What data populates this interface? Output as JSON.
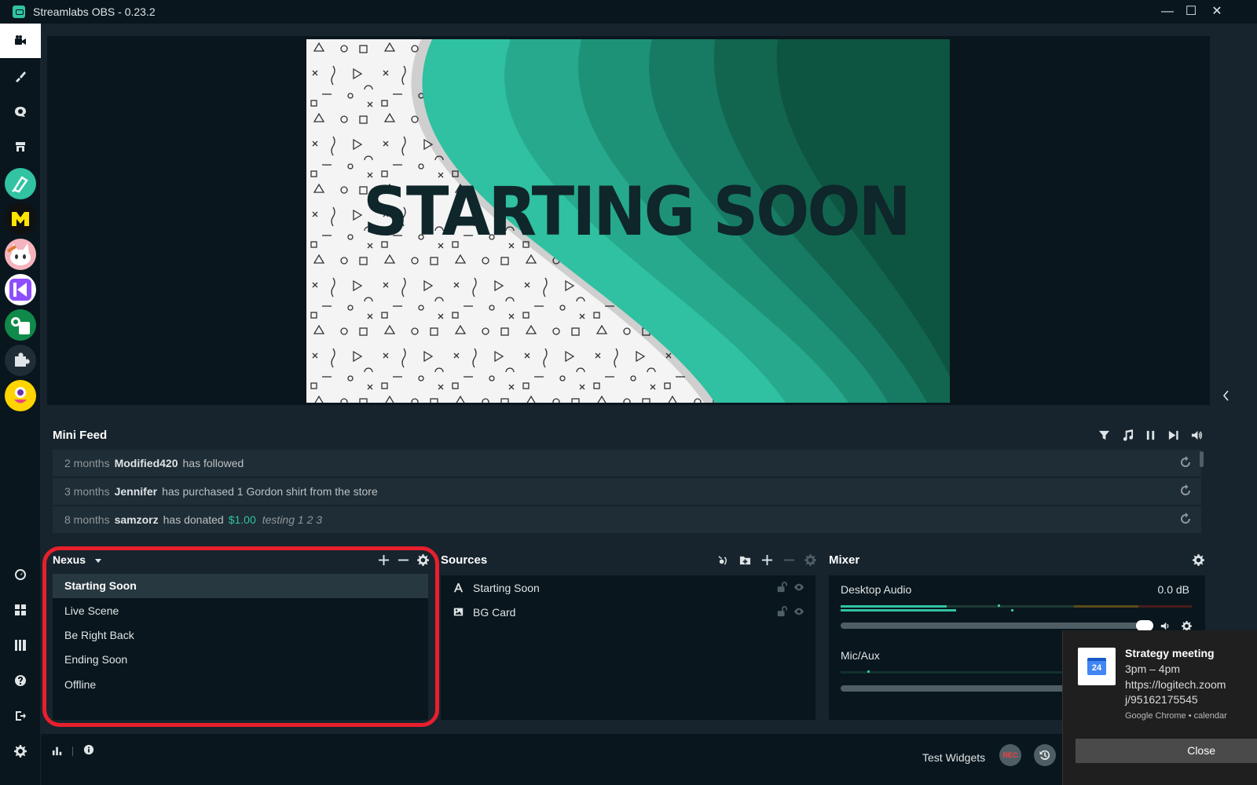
{
  "window": {
    "title": "Streamlabs OBS - 0.23.2"
  },
  "preview": {
    "headline": "STARTING SOON"
  },
  "minifeed": {
    "title": "Mini Feed",
    "events": [
      {
        "time": "2 months",
        "name": "Modified420",
        "message": "has followed",
        "amount": "",
        "note": ""
      },
      {
        "time": "3 months",
        "name": "Jennifer",
        "message": "has purchased 1 Gordon shirt from the store",
        "amount": "",
        "note": ""
      },
      {
        "time": "8 months",
        "name": "samzorz",
        "message": "has donated",
        "amount": "$1.00",
        "note": "testing 1 2 3"
      }
    ]
  },
  "scenes": {
    "collection": "Nexus",
    "items": [
      "Starting Soon",
      "Live Scene",
      "Be Right Back",
      "Ending Soon",
      "Offline"
    ],
    "selected": "Starting Soon"
  },
  "sources": {
    "title": "Sources",
    "items": [
      {
        "name": "Starting Soon",
        "icon": "text-icon"
      },
      {
        "name": "BG Card",
        "icon": "image-icon"
      }
    ]
  },
  "mixer": {
    "title": "Mixer",
    "channels": [
      {
        "name": "Desktop Audio",
        "level": "0.0 dB"
      },
      {
        "name": "Mic/Aux",
        "level": ""
      }
    ]
  },
  "footer": {
    "test_widgets": "Test Widgets",
    "rec_label": "REC"
  },
  "notification": {
    "title": "Strategy meeting",
    "time": "3pm – 4pm",
    "line1": "https://logitech.zoom",
    "line2": "j/95162175545",
    "source": "Google Chrome • calendar",
    "close": "Close",
    "icon_day": "24"
  },
  "colors": {
    "accent": "#31c3a2",
    "highlight": "#e81f2d",
    "panel": "#17242d",
    "background": "#09161d"
  }
}
